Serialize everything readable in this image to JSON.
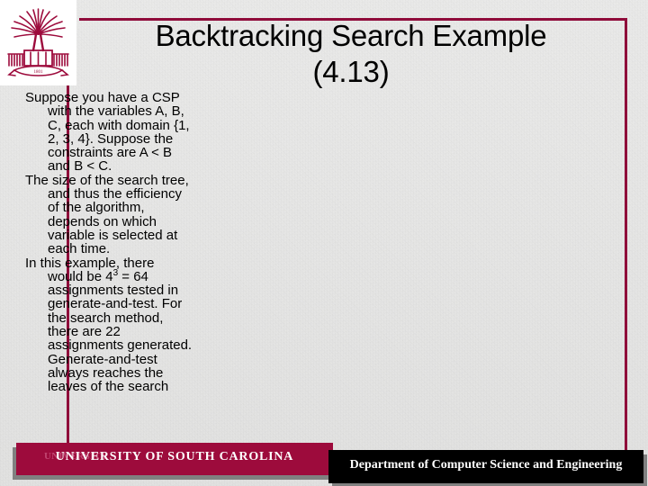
{
  "slide": {
    "title_line1": "Backtracking Search Example",
    "title_line2": "(4.13)",
    "background_color": "#ededec",
    "accent_color": "#8f0b3a",
    "footer_maroon_color": "#9d0b3c",
    "footer_black_color": "#000000"
  },
  "logo": {
    "name": "university-of-south-carolina-seal",
    "color": "#9d0b3c",
    "banner_text": "1801"
  },
  "body": {
    "paragraphs": [
      {
        "text": "Suppose you have a CSP with the variables A, B, C, each with domain {1, 2, 3, 4}. Suppose the constraints are A < B and B < C."
      },
      {
        "text": "The size of the search tree, and thus the efficiency of the algorithm, depends on which variable is selected at each time."
      },
      {
        "pre": "In this example, there would be 4",
        "sup": "3",
        "post": " = 64 assignments tested in generate-and-test. For the search method, there are 22 assignments generated. Generate-and-test always reaches the leaves of the search"
      }
    ]
  },
  "footer": {
    "left_label": "UNIVERSITY OF SOUTH CAROLINA",
    "left_ghost_label": "UNIVERSITY",
    "right_label": "Department of Computer Science and Engineering"
  }
}
